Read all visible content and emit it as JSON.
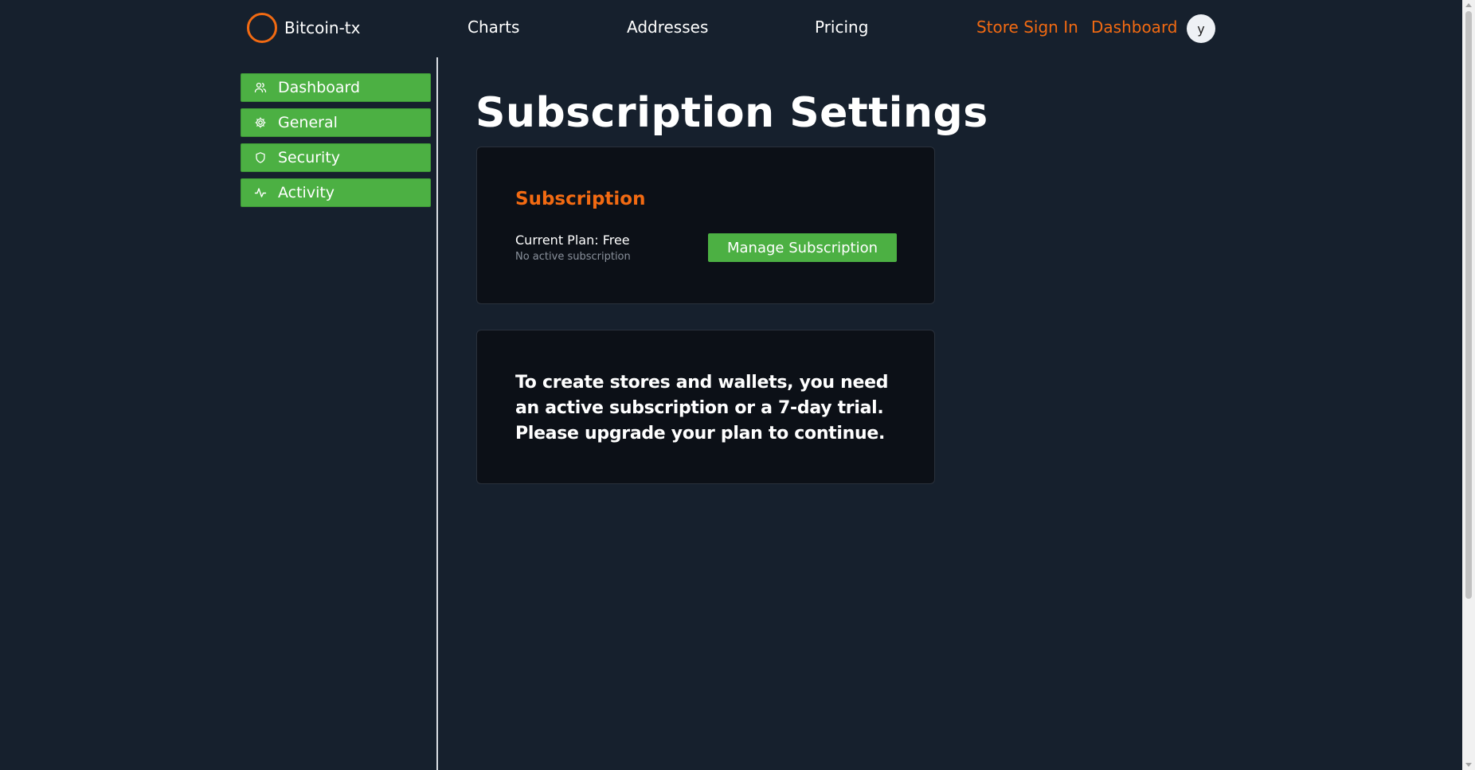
{
  "header": {
    "brand": "Bitcoin-tx",
    "nav": {
      "charts": "Charts",
      "addresses": "Addresses",
      "pricing": "Pricing"
    },
    "store_sign_in": "Store Sign In",
    "dashboard": "Dashboard",
    "avatar_initial": "y"
  },
  "sidebar": {
    "items": [
      {
        "label": "Dashboard",
        "icon": "users-icon"
      },
      {
        "label": "General",
        "icon": "gear-icon"
      },
      {
        "label": "Security",
        "icon": "shield-icon"
      },
      {
        "label": "Activity",
        "icon": "activity-icon"
      }
    ]
  },
  "main": {
    "title": "Subscription Settings",
    "subscription_card": {
      "heading": "Subscription",
      "current_plan": "Current Plan: Free",
      "note": "No active subscription",
      "manage_button": "Manage Subscription"
    },
    "message_card": {
      "text": "To create stores and wallets, you need an active subscription or a 7-day trial. Please upgrade your plan to continue."
    }
  },
  "colors": {
    "background": "#16202d",
    "accent_orange": "#f26a12",
    "accent_green": "#4cb043",
    "card": "#0c1017"
  }
}
